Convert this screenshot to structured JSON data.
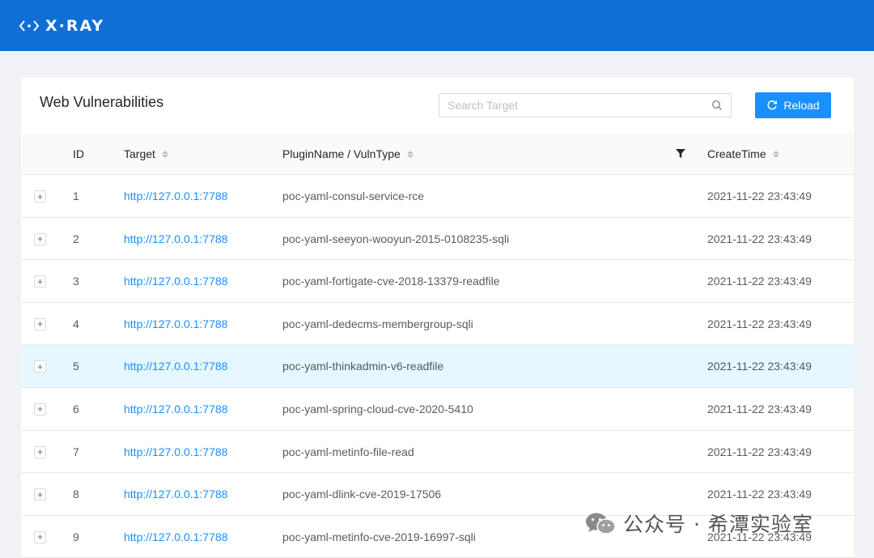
{
  "app": {
    "logo_text": "X·RAY",
    "logo_icon": "diamond-dots-icon",
    "brand_color": "#0f6fd4"
  },
  "page": {
    "title": "Web Vulnerabilities"
  },
  "search": {
    "placeholder": "Search Target",
    "value": ""
  },
  "toolbar": {
    "reload_label": "Reload",
    "accent": "#1890ff"
  },
  "table": {
    "columns": [
      {
        "label": "ID",
        "sortable": false
      },
      {
        "label": "Target",
        "sortable": true
      },
      {
        "label": "PluginName / VulnType",
        "sortable": true,
        "filterable": true
      },
      {
        "label": "CreateTime",
        "sortable": true
      }
    ],
    "rows": [
      {
        "expand": "+",
        "id": "1",
        "target": "http://127.0.0.1:7788",
        "plugin": "poc-yaml-consul-service-rce",
        "time": "2021-11-22 23:43:49"
      },
      {
        "expand": "+",
        "id": "2",
        "target": "http://127.0.0.1:7788",
        "plugin": "poc-yaml-seeyon-wooyun-2015-0108235-sqli",
        "time": "2021-11-22 23:43:49"
      },
      {
        "expand": "+",
        "id": "3",
        "target": "http://127.0.0.1:7788",
        "plugin": "poc-yaml-fortigate-cve-2018-13379-readfile",
        "time": "2021-11-22 23:43:49"
      },
      {
        "expand": "+",
        "id": "4",
        "target": "http://127.0.0.1:7788",
        "plugin": "poc-yaml-dedecms-membergroup-sqli",
        "time": "2021-11-22 23:43:49"
      },
      {
        "expand": "+",
        "id": "5",
        "target": "http://127.0.0.1:7788",
        "plugin": "poc-yaml-thinkadmin-v6-readfile",
        "time": "2021-11-22 23:43:49",
        "highlighted": true
      },
      {
        "expand": "+",
        "id": "6",
        "target": "http://127.0.0.1:7788",
        "plugin": "poc-yaml-spring-cloud-cve-2020-5410",
        "time": "2021-11-22 23:43:49"
      },
      {
        "expand": "+",
        "id": "7",
        "target": "http://127.0.0.1:7788",
        "plugin": "poc-yaml-metinfo-file-read",
        "time": "2021-11-22 23:43:49"
      },
      {
        "expand": "+",
        "id": "8",
        "target": "http://127.0.0.1:7788",
        "plugin": "poc-yaml-dlink-cve-2019-17506",
        "time": "2021-11-22 23:43:49"
      },
      {
        "expand": "+",
        "id": "9",
        "target": "http://127.0.0.1:7788",
        "plugin": "poc-yaml-metinfo-cve-2019-16997-sqli",
        "time": "2021-11-22 23:43:49"
      }
    ]
  },
  "watermark": {
    "text": "公众号 · 希潭实验室",
    "icon": "wechat-icon"
  }
}
